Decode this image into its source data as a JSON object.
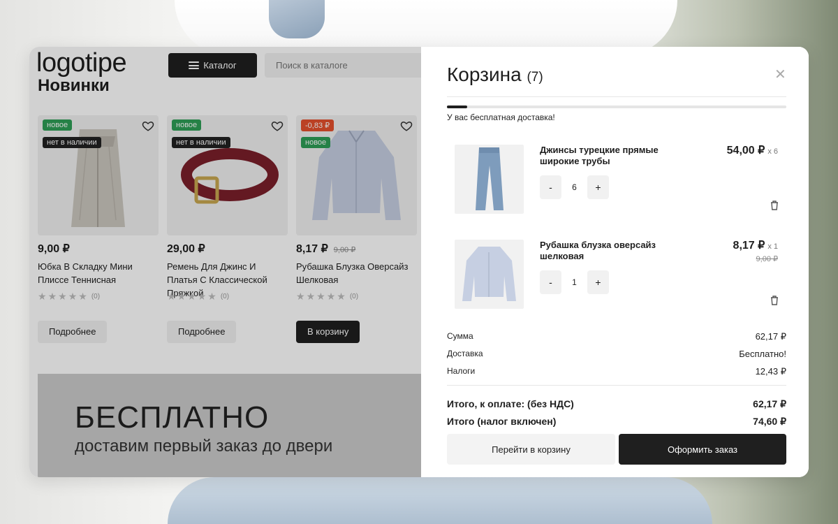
{
  "header": {
    "logo": "logotipe",
    "catalog_label": "Каталог",
    "search_placeholder": "Поиск в каталоге"
  },
  "section_title": "Новинки",
  "products": [
    {
      "badges": [
        "новое",
        "нет в наличии"
      ],
      "price": "9,00 ₽",
      "old_price": "",
      "name": "Юбка В Складку Мини Плиссе Теннисная",
      "rating_count": "(0)",
      "button": "Подробнее"
    },
    {
      "badges": [
        "новое",
        "нет в наличии"
      ],
      "price": "29,00 ₽",
      "old_price": "",
      "name": "Ремень Для Джинс И Платья С Классической Пряжкой",
      "rating_count": "(0)",
      "button": "Подробнее"
    },
    {
      "badges": [
        "-0,83 ₽",
        "новое"
      ],
      "price": "8,17 ₽",
      "old_price": "9,00 ₽",
      "name": "Рубашка Блузка Оверсайз Шелковая",
      "rating_count": "(0)",
      "button": "В корзину"
    }
  ],
  "banner": {
    "title": "БЕСПЛАТНО",
    "subtitle": "доставим первый заказ до двери"
  },
  "cart": {
    "title": "Корзина",
    "count": "(7)",
    "free_shipping_progress": 0.06,
    "shipping_note": "У вас бесплатная доставка!",
    "items": [
      {
        "name": "Джинсы турецкие прямые широкие трубы",
        "price": "54,00 ₽",
        "multiplier": "x 6",
        "old_price": "",
        "qty": "6",
        "minus": "-",
        "plus": "+"
      },
      {
        "name": "Рубашка блузка оверсайз шелковая",
        "price": "8,17 ₽",
        "multiplier": "x 1",
        "old_price": "9,00 ₽",
        "qty": "1",
        "minus": "-",
        "plus": "+"
      }
    ],
    "summary": {
      "sum_label": "Сумма",
      "sum_value": "62,17 ₽",
      "delivery_label": "Доставка",
      "delivery_value": "Бесплатно!",
      "tax_label": "Налоги",
      "tax_value": "12,43 ₽"
    },
    "totals": {
      "no_vat_label": "Итого, к оплате: (без НДС)",
      "no_vat_value": "62,17 ₽",
      "with_tax_label": "Итого (налог включен)",
      "with_tax_value": "74,60 ₽"
    },
    "go_to_cart": "Перейти в корзину",
    "checkout": "Оформить заказ"
  },
  "colors": {
    "accent_dark": "#1f1f1f",
    "badge_new": "#2e9e56",
    "badge_discount": "#e5502c"
  }
}
